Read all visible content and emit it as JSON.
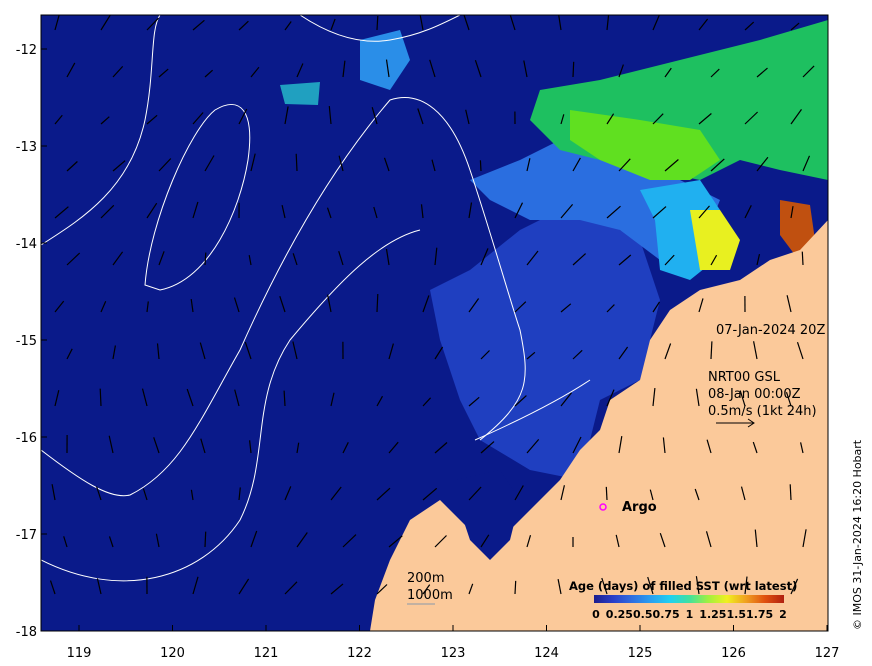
{
  "x_ticks": [
    "119",
    "120",
    "121",
    "122",
    "123",
    "124",
    "125",
    "126",
    "127"
  ],
  "y_ticks": [
    "-12",
    "-13",
    "-14",
    "-15",
    "-16",
    "-17",
    "-18"
  ],
  "timestamp_label": "07-Jan-2024 20Z",
  "product": {
    "name": "NRT00 GSL",
    "valid": "08-Jan 00:00Z",
    "vector_scale": "0.5m/s (1kt 24h)"
  },
  "argo_label": "Argo",
  "isobath_labels": [
    "200m",
    "1000m"
  ],
  "colorbar": {
    "title": "Age (days) of filled SST (wrt latest)",
    "ticks": [
      "0",
      "0.25",
      "0.5",
      "0.75",
      "1",
      "1.25",
      "1.5",
      "1.75",
      "2"
    ],
    "colors": [
      "#1e1e8c",
      "#2a3ec8",
      "#2f6ee0",
      "#2aa0f0",
      "#20d0f0",
      "#40e0a0",
      "#a0f040",
      "#f0f020",
      "#f0a020",
      "#e05010",
      "#b02010"
    ]
  },
  "credit": "© IMOS 31-Jan-2024 16:20 Hobart",
  "colors": {
    "ocean": "#0a1a8a",
    "land": "#fbc99a",
    "accent_argo": "#ff00ff"
  }
}
